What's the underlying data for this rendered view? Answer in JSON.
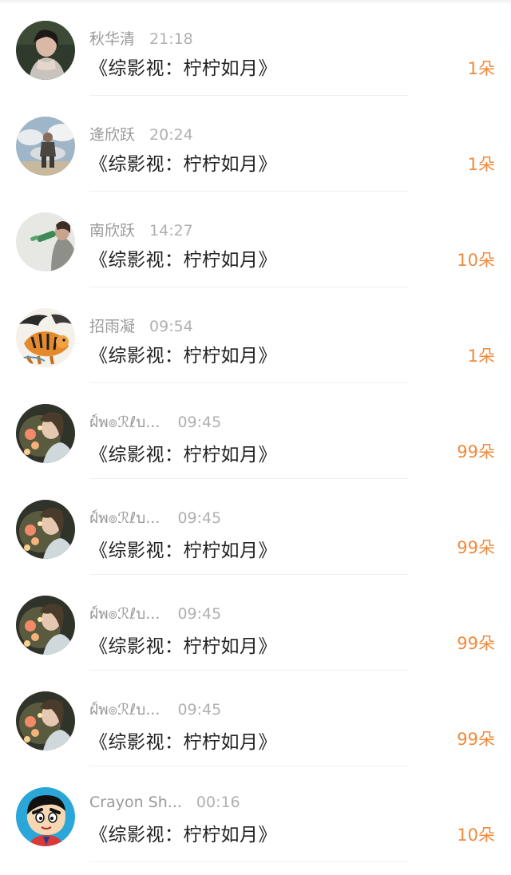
{
  "colors": {
    "accent_count": "#f08a3c",
    "name_gray": "#9a9a9a",
    "title_dark": "#222222"
  },
  "items": [
    {
      "name": "秋华清",
      "time": "21:18",
      "title": "《综影视：柠柠如月》",
      "count": "1朵",
      "avatar": "woman-dark-portrait"
    },
    {
      "name": "逄欣跃",
      "time": "20:24",
      "title": "《综影视：柠柠如月》",
      "count": "1朵",
      "avatar": "cloud-sky-figure"
    },
    {
      "name": "南欣跃",
      "time": "14:27",
      "title": "《综影视：柠柠如月》",
      "count": "10朵",
      "avatar": "person-drinking"
    },
    {
      "name": "招雨凝",
      "time": "09:54",
      "title": "《综影视：柠柠如月》",
      "count": "1朵",
      "avatar": "tiger-painting"
    },
    {
      "name": "ฝ์พ๏ℛℓบ...",
      "time": "09:45",
      "title": "《综影视：柠柠如月》",
      "count": "99朵",
      "avatar": "girl-flowers-light"
    },
    {
      "name": "ฝ์พ๏ℛℓบ...",
      "time": "09:45",
      "title": "《综影视：柠柠如月》",
      "count": "99朵",
      "avatar": "girl-flowers-light"
    },
    {
      "name": "ฝ์พ๏ℛℓบ...",
      "time": "09:45",
      "title": "《综影视：柠柠如月》",
      "count": "99朵",
      "avatar": "girl-flowers-light"
    },
    {
      "name": "ฝ์พ๏ℛℓบ...",
      "time": "09:45",
      "title": "《综影视：柠柠如月》",
      "count": "99朵",
      "avatar": "girl-flowers-light"
    },
    {
      "name": "Crayon Sh...",
      "time": "00:16",
      "title": "《综影视：柠柠如月》",
      "count": "10朵",
      "avatar": "crayon-shin-chan"
    }
  ]
}
